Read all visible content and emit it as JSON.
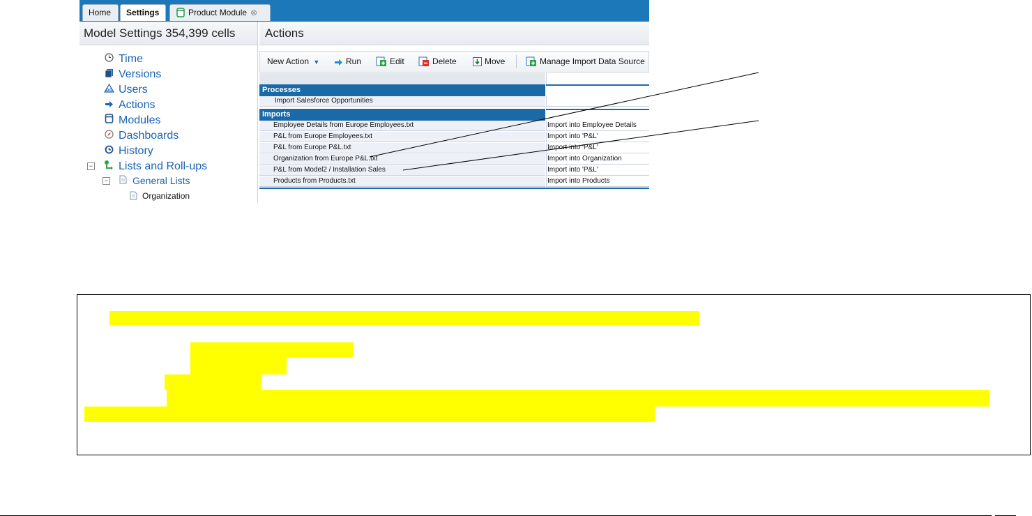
{
  "tabs": [
    {
      "label": "Home"
    },
    {
      "label": "Settings"
    },
    {
      "label": "Product Module"
    }
  ],
  "left_panel": {
    "title": "Model Settings 354,399 cells",
    "items": [
      {
        "label": "Time",
        "icon": "clock-icon"
      },
      {
        "label": "Versions",
        "icon": "versions-icon"
      },
      {
        "label": "Users",
        "icon": "users-icon"
      },
      {
        "label": "Actions",
        "icon": "arrow-right-icon"
      },
      {
        "label": "Modules",
        "icon": "module-icon"
      },
      {
        "label": "Dashboards",
        "icon": "compass-icon"
      },
      {
        "label": "History",
        "icon": "history-icon"
      },
      {
        "label": "Lists and Roll-ups",
        "icon": "lists-icon"
      },
      {
        "label": "General Lists",
        "icon": "document-icon"
      },
      {
        "label": "Organization",
        "icon": "document-icon"
      }
    ]
  },
  "right_panel": {
    "title": "Actions",
    "toolbar": {
      "new_action": "New Action",
      "run": "Run",
      "edit": "Edit",
      "delete": "Delete",
      "move": "Move",
      "manage_import": "Manage Import Data Source"
    },
    "sections": [
      {
        "title": "Processes",
        "rows": [
          {
            "name": "Import Salesforce Opportunities",
            "detail": ""
          }
        ]
      },
      {
        "title": "Imports",
        "rows": [
          {
            "name": "Employee Details from Europe Employees.txt",
            "detail": "Import into Employee Details"
          },
          {
            "name": "P&L from Europe Employees.txt",
            "detail": "Import into 'P&L'"
          },
          {
            "name": "P&L from Europe P&L.txt",
            "detail": "Import into 'P&L'"
          },
          {
            "name": "Organization from Europe P&L.txt",
            "detail": "Import into Organization"
          },
          {
            "name": "P&L from Model2 / Installation Sales",
            "detail": "Import into 'P&L'"
          },
          {
            "name": "Products from Products.txt",
            "detail": "Import into Products"
          }
        ]
      }
    ]
  },
  "colors": {
    "tabbar": "#1c78b8",
    "section_header": "#1b6aa8",
    "highlight": "#ffff00",
    "link": "#1b64b4"
  }
}
